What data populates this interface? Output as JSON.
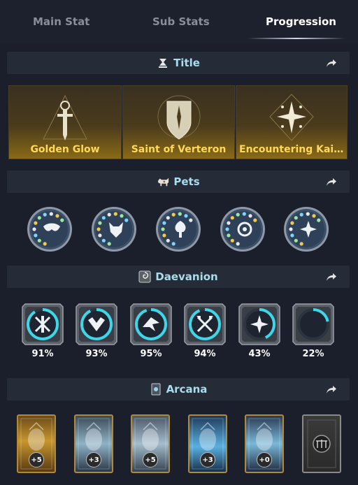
{
  "tabs": [
    {
      "label": "Main Stat",
      "active": false
    },
    {
      "label": "Sub Stats",
      "active": false
    },
    {
      "label": "Progression",
      "active": true
    }
  ],
  "sections": {
    "title": {
      "label": "Title",
      "icon": "title-icon"
    },
    "pets": {
      "label": "Pets",
      "icon": "pet-icon"
    },
    "daevanion": {
      "label": "Daevanion",
      "icon": "daevanion-icon"
    },
    "arcana": {
      "label": "Arcana",
      "icon": "arcana-icon"
    }
  },
  "titles": [
    {
      "name": "Golden Glow",
      "icon": "sword-triangle-icon"
    },
    {
      "name": "Saint of Verteron",
      "icon": "shield-star-icon"
    },
    {
      "name": "Encountering Kai...",
      "icon": "sparkle-diamond-icon"
    }
  ],
  "pets": [
    {
      "icon": "mask-icon"
    },
    {
      "icon": "wolf-icon"
    },
    {
      "icon": "tree-icon"
    },
    {
      "icon": "eye-icon"
    },
    {
      "icon": "flower-icon"
    }
  ],
  "daevanion": [
    {
      "percent": "91%",
      "progress": 0.91,
      "icon": "crossed-swords-icon"
    },
    {
      "percent": "93%",
      "progress": 0.93,
      "icon": "shield-wings-icon"
    },
    {
      "percent": "95%",
      "progress": 0.95,
      "icon": "bird-icon"
    },
    {
      "percent": "94%",
      "progress": 0.94,
      "icon": "crossed-axes-icon"
    },
    {
      "percent": "43%",
      "progress": 0.43,
      "icon": "cross-star-icon"
    },
    {
      "percent": "22%",
      "progress": 0.22,
      "icon": "crescent-moon-icon"
    }
  ],
  "arcana": [
    {
      "level": "+5",
      "icon": "golden-chalice-icon",
      "locked": false
    },
    {
      "level": "+3",
      "icon": "waterfall-icon",
      "locked": false
    },
    {
      "level": "+5",
      "icon": "compass-icon",
      "locked": false
    },
    {
      "level": "+3",
      "icon": "crystal-orb-icon",
      "locked": false
    },
    {
      "level": "+0",
      "icon": "spirit-icon",
      "locked": false
    },
    {
      "level": "",
      "icon": "locked-card-icon",
      "locked": true
    }
  ],
  "colors": {
    "background": "#1b1f2b",
    "header_bg": "#262b38",
    "header_text": "#a9dcec",
    "title_text": "#ffd85a",
    "progress_ring": "#3fd6e8"
  }
}
